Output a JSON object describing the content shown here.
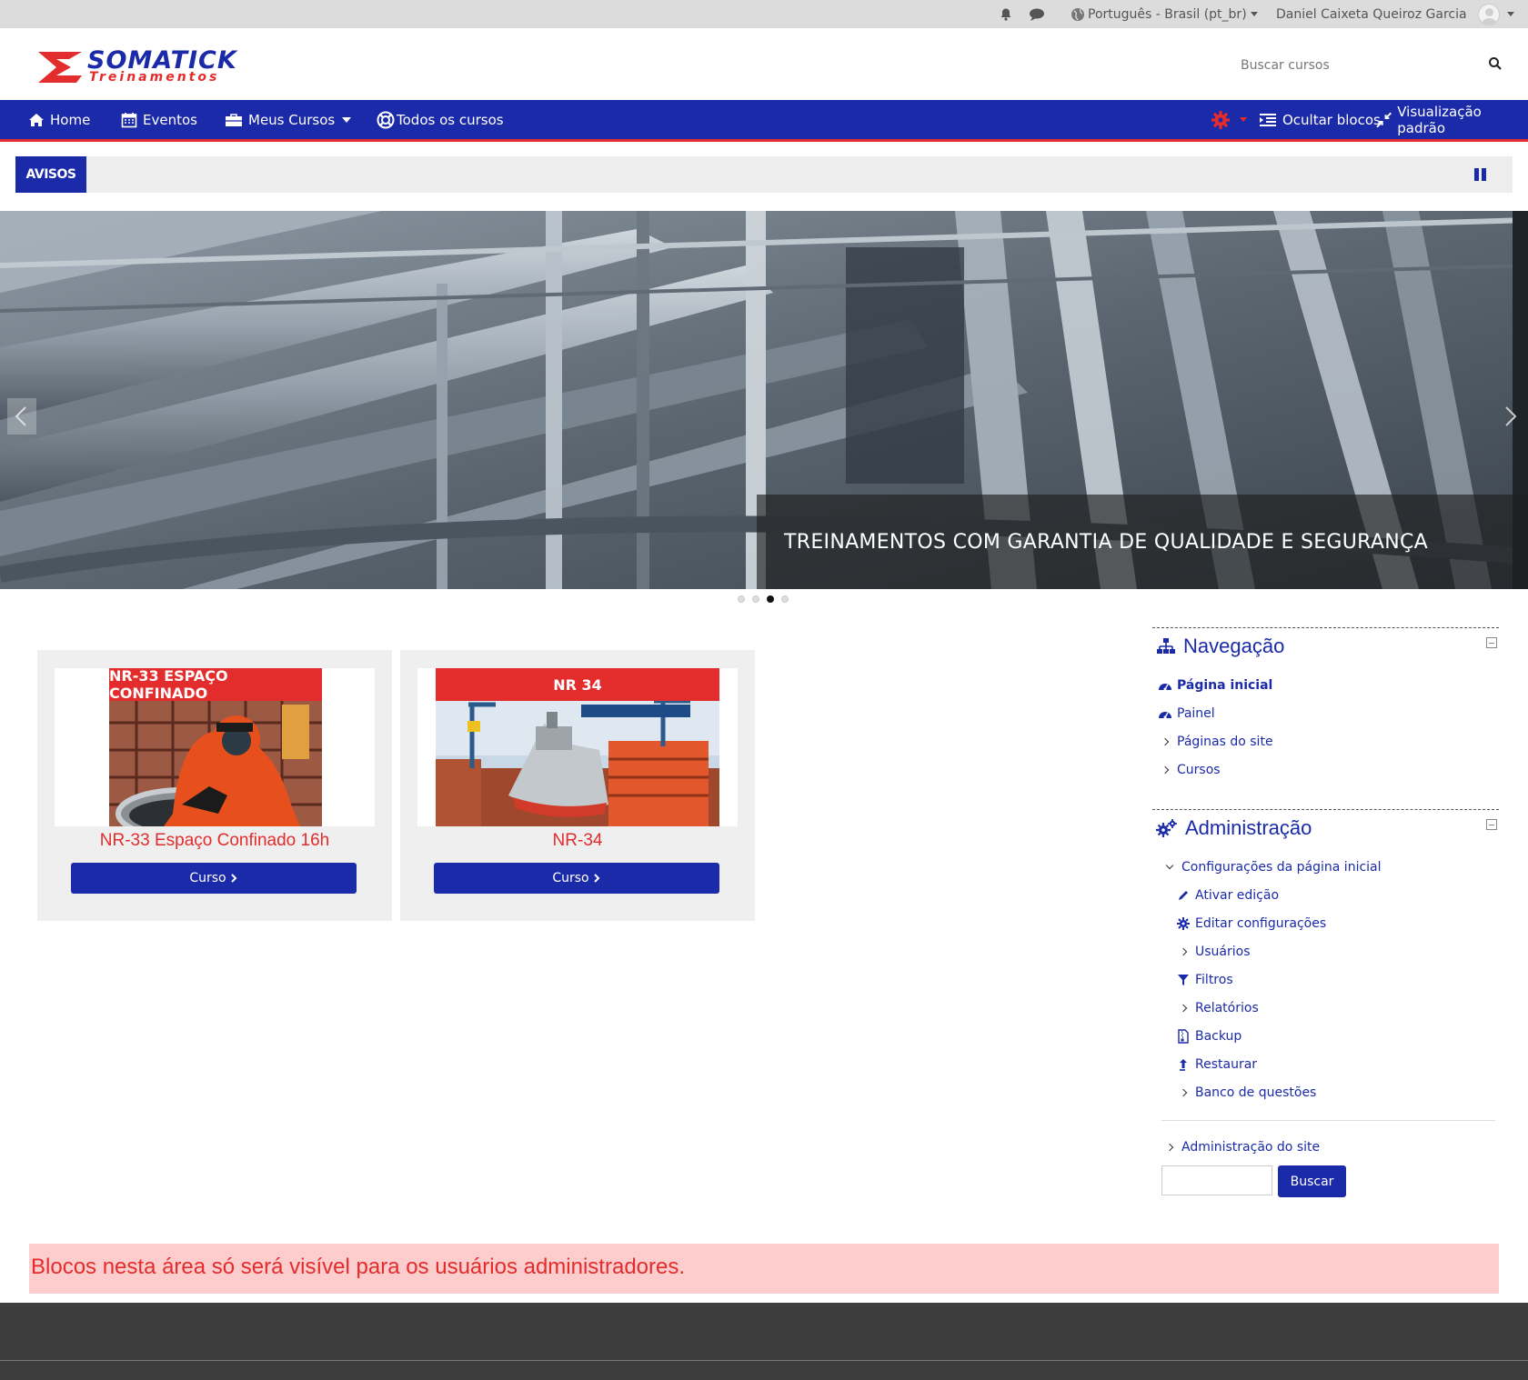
{
  "topbar": {
    "language": "Português - Brasil (pt_br)",
    "user_name": "Daniel Caixeta Queiroz Garcia",
    "icons": [
      "bell-icon",
      "chat-icon",
      "globe-icon"
    ]
  },
  "header": {
    "logo_main": "SOMATICK",
    "logo_sub": "Treinamentos",
    "search_placeholder": "Buscar cursos"
  },
  "nav": {
    "home": "Home",
    "eventos": "Eventos",
    "meus_cursos": "Meus Cursos",
    "todos_cursos": "Todos os cursos",
    "ocultar_blocos": "Ocultar blocos",
    "visualizacao": "Visualização padrão"
  },
  "avisos": {
    "label": "AVISOS"
  },
  "slider": {
    "caption": "TREINAMENTOS COM GARANTIA DE QUALIDADE E SEGURANÇA",
    "slide_count": 4,
    "active_slide": 3
  },
  "courses": [
    {
      "banner": "NR-33  ESPAÇO CONFINADO",
      "title": "NR-33 Espaço Confinado 16h",
      "button": "Curso"
    },
    {
      "banner": "NR 34",
      "title": "NR-34",
      "button": "Curso"
    }
  ],
  "navegacao": {
    "title": "Navegação",
    "items": [
      "Página inicial",
      "Painel",
      "Páginas do site",
      "Cursos"
    ]
  },
  "administracao": {
    "title": "Administração",
    "section": "Configurações da página inicial",
    "items": [
      "Ativar edição",
      "Editar configurações",
      "Usuários",
      "Filtros",
      "Relatórios",
      "Backup",
      "Restaurar",
      "Banco de questões"
    ],
    "site_admin": "Administração do site",
    "search_button": "Buscar"
  },
  "notice": {
    "text": "Blocos nesta área só será visível para os usuários administradores."
  },
  "colors": {
    "brand_blue": "#1a2aa8",
    "brand_red": "#e32c2c",
    "footer": "#3d3d3d"
  }
}
